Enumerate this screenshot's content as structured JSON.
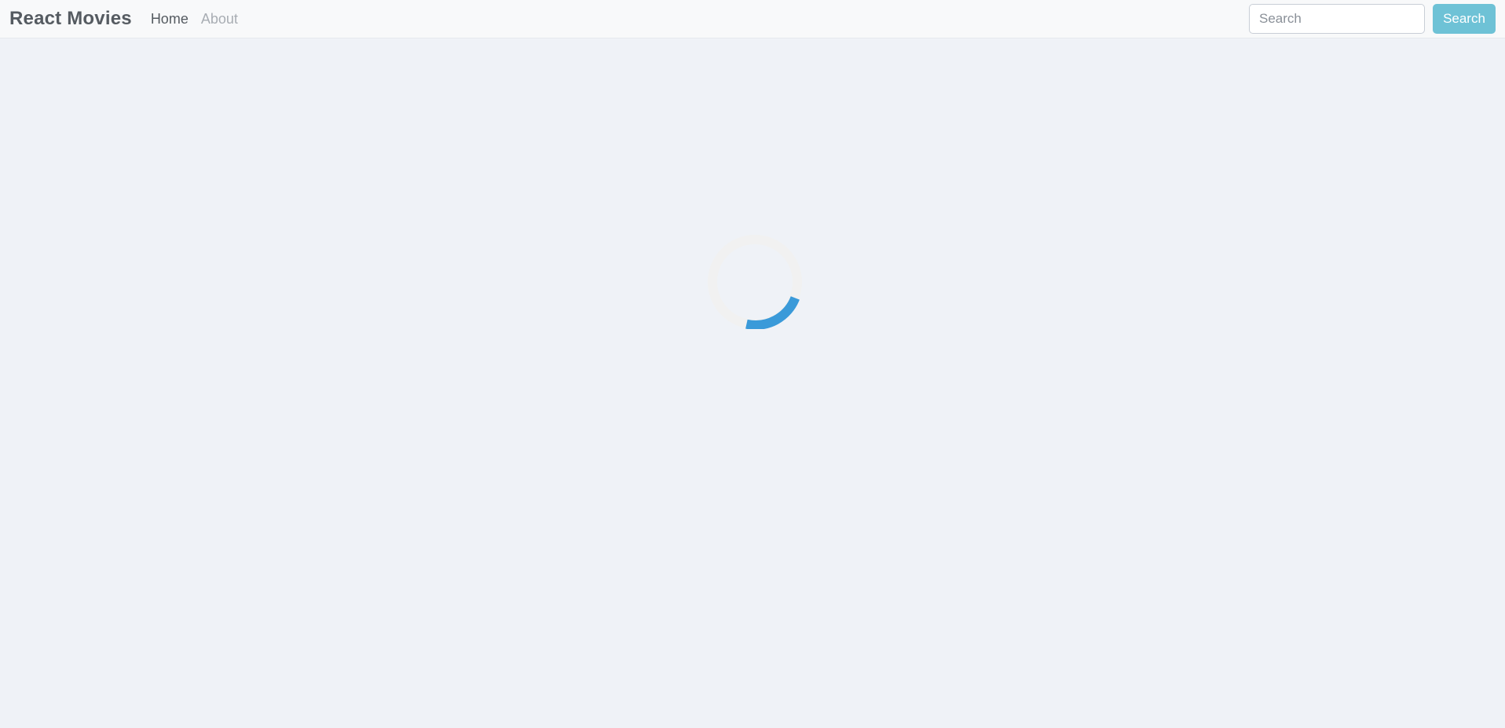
{
  "navbar": {
    "brand": "React Movies",
    "links": [
      {
        "label": "Home"
      },
      {
        "label": "About"
      }
    ],
    "search": {
      "placeholder": "Search",
      "button_label": "Search"
    }
  },
  "loader": {
    "state": "loading",
    "accent_color": "#3a9ad9",
    "track_color": "#f1f1f1"
  }
}
